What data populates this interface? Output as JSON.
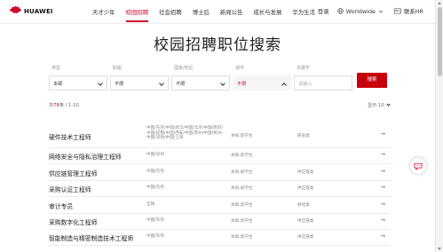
{
  "header": {
    "logo_text": "HUAWEI",
    "nav": [
      "天才少年",
      "校园招聘",
      "社会招聘",
      "博士后",
      "新闻公告",
      "成长与发展",
      "华为生活"
    ],
    "active_index": 1,
    "login": "登录",
    "language": "Worldwide",
    "contact": "联系HR"
  },
  "page": {
    "title": "校园招聘职位搜索"
  },
  "filters": [
    {
      "label": "类型",
      "value": "本硕",
      "focused": false
    },
    {
      "label": "职能",
      "value": "不限",
      "focused": false
    },
    {
      "label": "国家/地区",
      "value": "不限",
      "focused": false
    },
    {
      "label": "城市",
      "value": "不限",
      "focused": true
    },
    {
      "label": "关键字",
      "value": "",
      "placeholder": "请输入",
      "focused": false
    }
  ],
  "search_button": "搜索",
  "results": {
    "total_prefix": "共",
    "total_count": "78",
    "total_suffix": "条 / 1-10",
    "per_page_label": "显示",
    "per_page_value": "10"
  },
  "rows": [
    {
      "title": "硬件技术工程师",
      "location": "中国/东莞/中国/武汉/中国/北京/中国/南京/中国/成都/中国/西安/中国/苏州/中国/杭州/中国/深圳/中国/上海",
      "education": "本硕,留学生",
      "dept": "研发类"
    },
    {
      "title": "网络安全与隐私治理工程师",
      "location": "中国/深圳",
      "education": "本硕,留学生",
      "dept": ""
    },
    {
      "title": "供应链管理工程师",
      "location": "中国/东莞",
      "education": "本硕,留学生",
      "dept": "供应链类"
    },
    {
      "title": "采购认证工程师",
      "location": "中国/东莞",
      "education": "本硕,留学生",
      "dept": "供应链类"
    },
    {
      "title": "审计专员",
      "location": "全球",
      "education": "本硕,留学生",
      "dept": "财经类"
    },
    {
      "title": "采购数字化工程师",
      "location": "中国/东莞",
      "education": "本硕,留学生",
      "dept": "供应链类"
    },
    {
      "title": "智能制造与精密制造技术工程师",
      "location": "中国/东莞",
      "education": "本硕,留学生",
      "dept": "供应链类"
    }
  ],
  "arrow_glyph": "→",
  "colors": {
    "brand": "#cf0a2c",
    "button": "#c7000b"
  }
}
